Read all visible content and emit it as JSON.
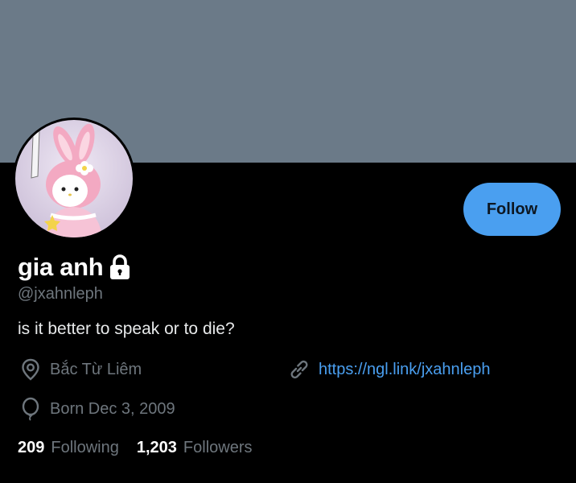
{
  "profile": {
    "display_name": "gia anh",
    "handle": "@jxahnleph",
    "bio": "is it better to speak or to die?",
    "location": "Bắc Từ Liêm",
    "website": "https://ngl.link/jxahnleph",
    "born": "Born Dec 3, 2009",
    "protected_icon": "lock-icon"
  },
  "actions": {
    "follow_label": "Follow"
  },
  "stats": {
    "following_count": "209",
    "following_label": "Following",
    "followers_count": "1,203",
    "followers_label": "Followers"
  },
  "colors": {
    "banner": "#6b7a88",
    "accent": "#4a9ff0",
    "muted": "#6e767d",
    "background": "#000000"
  }
}
